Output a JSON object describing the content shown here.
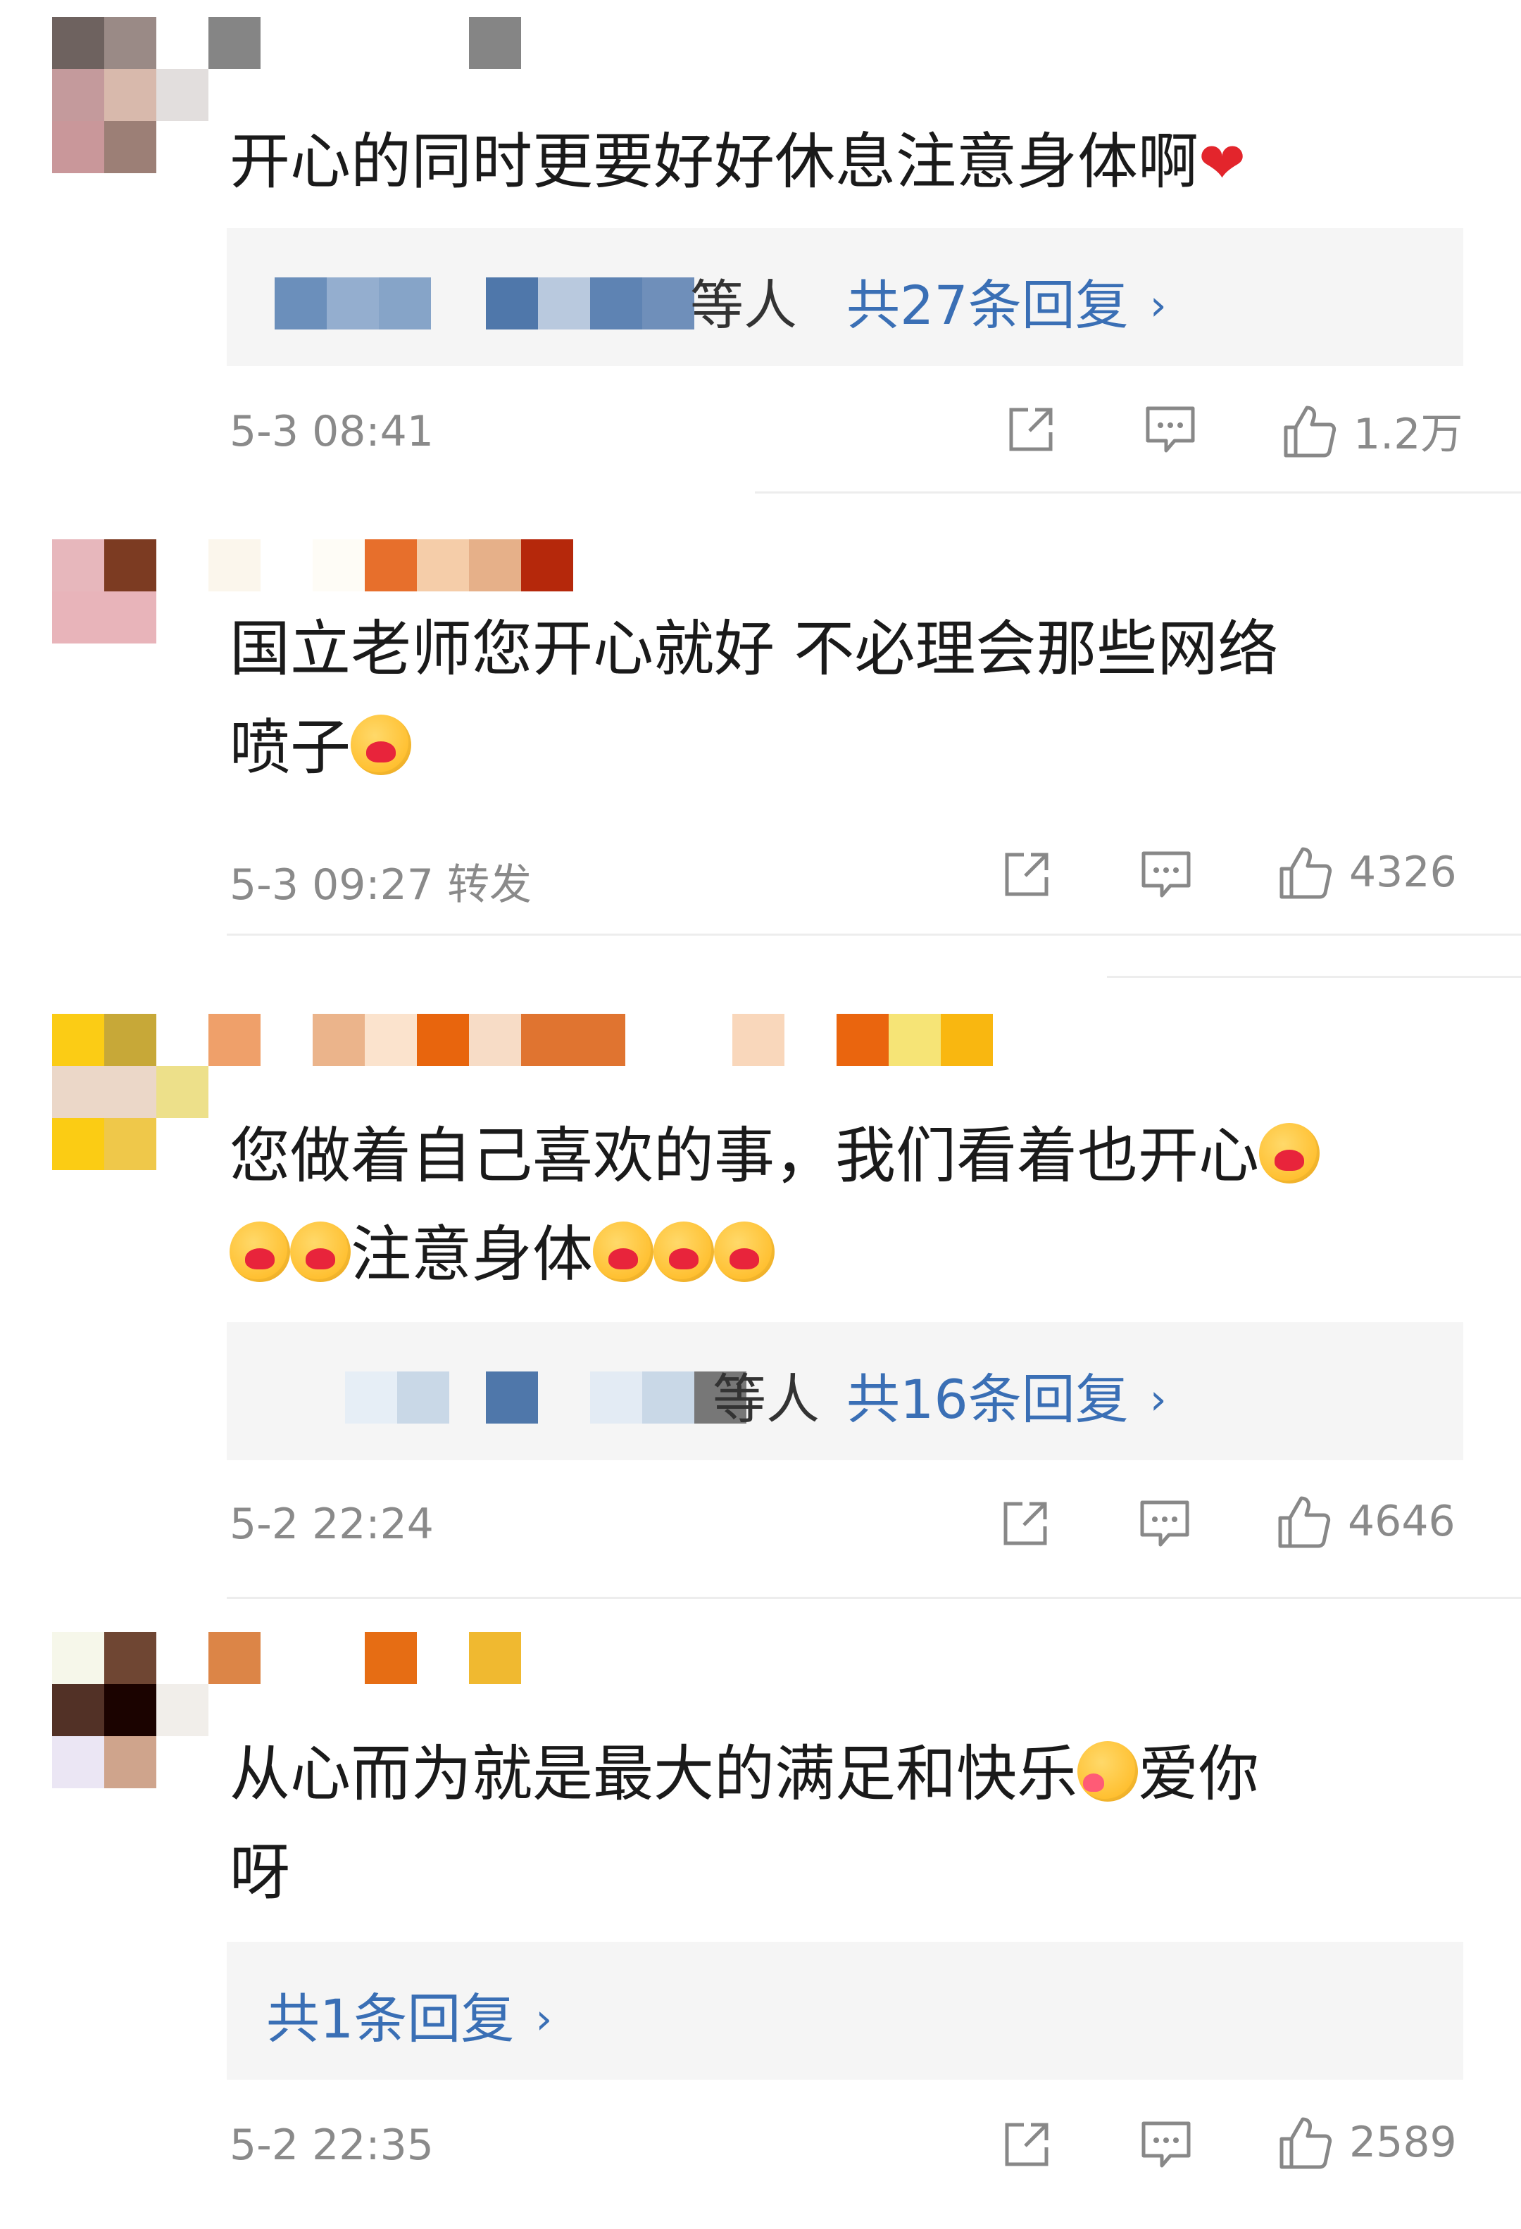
{
  "comments": [
    {
      "text": "开心的同时更要好好休息注意身体啊",
      "reply_suffix": "等人",
      "reply_count": "共27条回复",
      "time": "5-3 08:41",
      "likes": "1.2万"
    },
    {
      "text_line1": "国立老师您开心就好 不必理会那些网络",
      "text_line2": "喷子",
      "time": "5-3 09:27",
      "tag": "转发",
      "likes": "4326"
    },
    {
      "text_line1": "您做着自己喜欢的事，我们看着也开心",
      "text_line2": "注意身体",
      "reply_suffix": "等人",
      "reply_count": "共16条回复",
      "time": "5-2 22:24",
      "likes": "4646"
    },
    {
      "text_line1": "从心而为就是最大的满足和快乐",
      "text_line1b": "爱你",
      "text_line2": "呀",
      "reply_count": "共1条回复",
      "time": "5-2 22:35",
      "likes": "2589"
    }
  ],
  "icons": {
    "share": "share-icon",
    "comment": "comment-icon",
    "like": "thumbs-up-icon",
    "chevron": "chevron-right-icon"
  },
  "colors": {
    "link_blue": "#3a6fb5",
    "meta_gray": "#8a8a8a",
    "reply_bg": "#f5f5f5"
  }
}
